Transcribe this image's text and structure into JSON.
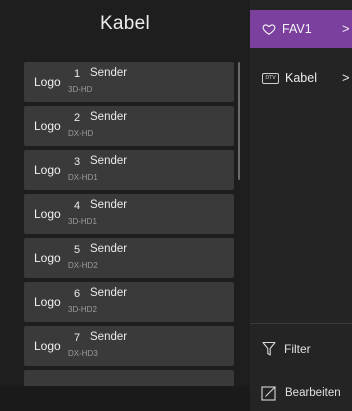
{
  "header": {
    "title": "Kabel"
  },
  "channels": [
    {
      "logo": "Logo",
      "number": "1",
      "name": "Sender",
      "sub": "3D-HD"
    },
    {
      "logo": "Logo",
      "number": "2",
      "name": "Sender",
      "sub": "DX-HD"
    },
    {
      "logo": "Logo",
      "number": "3",
      "name": "Sender",
      "sub": "DX-HD1"
    },
    {
      "logo": "Logo",
      "number": "4",
      "name": "Sender",
      "sub": "3D-HD1"
    },
    {
      "logo": "Logo",
      "number": "5",
      "name": "Sender",
      "sub": "DX-HD2"
    },
    {
      "logo": "Logo",
      "number": "6",
      "name": "Sender",
      "sub": "3D-HD2"
    },
    {
      "logo": "Logo",
      "number": "7",
      "name": "Sender",
      "sub": "DX-HD3"
    }
  ],
  "menu": {
    "fav": {
      "label": "FAV1",
      "icon": "heart-icon",
      "chevron": ">"
    },
    "source": {
      "label": "Kabel",
      "icon": "dtv-icon",
      "icon_text": "DTV",
      "chevron": ">"
    },
    "filter": {
      "label": "Filter",
      "icon": "filter-icon"
    },
    "edit": {
      "label": "Bearbeiten",
      "icon": "edit-icon"
    }
  },
  "colors": {
    "accent": "#7b3f9e",
    "row_bg": "#3a3a3a",
    "panel_bg": "#1e1e1e"
  }
}
